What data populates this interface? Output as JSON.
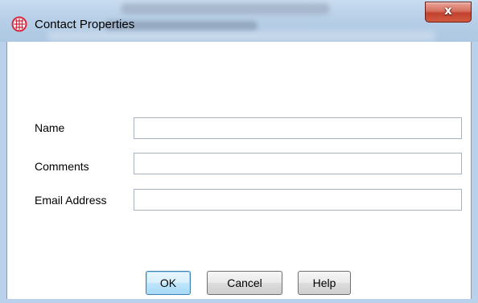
{
  "window": {
    "title": "Contact Properties",
    "icon": "globe-grid-icon",
    "close_glyph": "x"
  },
  "form": {
    "fields": [
      {
        "label": "Name",
        "value": ""
      },
      {
        "label": "Comments",
        "value": ""
      },
      {
        "label": "Email Address",
        "value": ""
      }
    ]
  },
  "buttons": {
    "ok": "OK",
    "cancel": "Cancel",
    "help": "Help"
  },
  "colors": {
    "titlebar": "#b7cfe7",
    "close_button": "#c1422f",
    "app_icon": "#d7263d",
    "default_button_border": "#3c7fb1"
  }
}
